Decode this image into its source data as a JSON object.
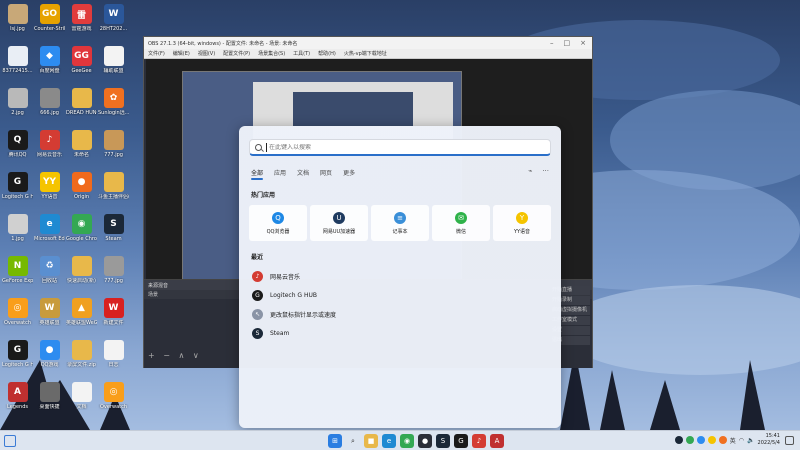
{
  "desktop": {
    "icons": [
      {
        "label": "lsj.jpg",
        "color": "#c8a878",
        "glyph": ""
      },
      {
        "label": "Counter-Strike Global Off...",
        "color": "#e6a200",
        "glyph": "GO"
      },
      {
        "label": "雷霆游戏",
        "color": "#e03c3c",
        "glyph": "雷"
      },
      {
        "label": "28HT202...",
        "color": "#2b579a",
        "glyph": "W"
      },
      {
        "label": "8377241​5...",
        "color": "#e9eef5",
        "glyph": ""
      },
      {
        "label": "百度网盘",
        "color": "#2d8cf0",
        "glyph": "◆"
      },
      {
        "label": "GeeGee",
        "color": "#e0363c",
        "glyph": "GG"
      },
      {
        "label": "辅助联盟",
        "color": "#f3f3f3",
        "glyph": ""
      },
      {
        "label": "2.jpg",
        "color": "#b9b9b9",
        "glyph": ""
      },
      {
        "label": "666.jpg",
        "color": "#8a8a8a",
        "glyph": ""
      },
      {
        "label": "DREAD HUNGER",
        "color": "#e8b84a",
        "glyph": ""
      },
      {
        "label": "Sunlogin远...",
        "color": "#f07020",
        "glyph": "✿"
      },
      {
        "label": "腾讯QQ",
        "color": "#1a1a1a",
        "glyph": "Q"
      },
      {
        "label": "网易云音乐",
        "color": "#d43c33",
        "glyph": "♪"
      },
      {
        "label": "未命名",
        "color": "#e8b84a",
        "glyph": ""
      },
      {
        "label": "777.jpg",
        "color": "#c89858",
        "glyph": ""
      },
      {
        "label": "Logitech G HUB",
        "color": "#1a1a1a",
        "glyph": "G"
      },
      {
        "label": "YY语音",
        "color": "#f5c400",
        "glyph": "YY"
      },
      {
        "label": "Origin",
        "color": "#f06a1c",
        "glyph": "●"
      },
      {
        "label": "斗鱼主播伴侣(新)",
        "color": "#e8b84a",
        "glyph": ""
      },
      {
        "label": "1.jpg",
        "color": "#d0d0d0",
        "glyph": ""
      },
      {
        "label": "Microsoft Edge",
        "color": "#1f8ad2",
        "glyph": "e"
      },
      {
        "label": "Google Chrome",
        "color": "#34a853",
        "glyph": "◉"
      },
      {
        "label": "Steam",
        "color": "#1b2838",
        "glyph": "S"
      },
      {
        "label": "GeForce Experience",
        "color": "#76b900",
        "glyph": "N"
      },
      {
        "label": "回收站",
        "color": "#5a8fd0",
        "glyph": "♻"
      },
      {
        "label": "快速启动(新)",
        "color": "#e8b84a",
        "glyph": ""
      },
      {
        "label": "777.jpg",
        "color": "#9a9a9a",
        "glyph": ""
      },
      {
        "label": "Overwatch",
        "color": "#f99e1a",
        "glyph": "◎"
      },
      {
        "label": "英雄联盟",
        "color": "#c89b3c",
        "glyph": "W"
      },
      {
        "label": "英雄联盟WeGame",
        "color": "#f0a020",
        "glyph": "▲"
      },
      {
        "label": "新建文件",
        "color": "#d82020",
        "glyph": "W"
      },
      {
        "label": "Logitech G HUB",
        "color": "#1a1a1a",
        "glyph": "G"
      },
      {
        "label": "QQ游戏",
        "color": "#2d8cf0",
        "glyph": "●"
      },
      {
        "label": "录屏文件.zip",
        "color": "#e8b84a",
        "glyph": ""
      },
      {
        "label": "日志",
        "color": "#f3f3f3",
        "glyph": ""
      },
      {
        "label": "Legends",
        "color": "#c03030",
        "glyph": "A"
      },
      {
        "label": "桌面快捷",
        "color": "#6a6a6a",
        "glyph": ""
      },
      {
        "label": "文档",
        "color": "#f3f3f3",
        "glyph": ""
      },
      {
        "label": "Overwatch",
        "color": "#f99e1a",
        "glyph": "◎"
      }
    ]
  },
  "obs": {
    "title": "OBS 27.1.3 (64-bit, windows) - 配置文件: 未命名 - 场景: 未命名",
    "menu": [
      "文件(F)",
      "编辑(E)",
      "视图(V)",
      "配置文件(P)",
      "场景集合(S)",
      "工具(T)",
      "帮助(H)",
      "火热-vp端下载地址"
    ],
    "dock_scene_title": "来源混音",
    "dock_scene_sub": "场景",
    "dock_source_title": "来源",
    "dock_tools": "+ − ∧ ∨",
    "right_items": [
      "开始直播",
      "开始录制",
      "启动虚拟摄像机",
      "工作室模式",
      "设置",
      "退出"
    ]
  },
  "start_menu": {
    "search_placeholder": "在此键入以搜索",
    "tabs": [
      "全部",
      "应用",
      "文档",
      "网页",
      "更多"
    ],
    "pinned_title": "热门应用",
    "pinned_apps": [
      {
        "label": "QQ浏览器",
        "color": "#1e88e5",
        "glyph": "Q"
      },
      {
        "label": "网易UU加速器",
        "color": "#1f3b60",
        "glyph": "U"
      },
      {
        "label": "记事本",
        "color": "#3a8fd8",
        "glyph": "≡"
      },
      {
        "label": "微信",
        "color": "#2fb24a",
        "glyph": "✉"
      },
      {
        "label": "YY语音",
        "color": "#f5c400",
        "glyph": "Y"
      }
    ],
    "recent_title": "最近",
    "recent_items": [
      {
        "label": "网易云音乐",
        "color": "#d43c33",
        "glyph": "♪"
      },
      {
        "label": "Logitech G HUB",
        "color": "#1a1a1a",
        "glyph": "G"
      },
      {
        "label": "更改鼠标指针显示或速度",
        "color": "#8a94a6",
        "glyph": "↖"
      },
      {
        "label": "Steam",
        "color": "#1b2838",
        "glyph": "S"
      }
    ]
  },
  "taskbar": {
    "apps": [
      {
        "name": "windows",
        "color": "#2a7de1",
        "glyph": "⊞"
      },
      {
        "name": "search",
        "color": "#dde5f0",
        "glyph": "⌕"
      },
      {
        "name": "file-explorer",
        "color": "#e8b84a",
        "glyph": "■"
      },
      {
        "name": "edge",
        "color": "#1f8ad2",
        "glyph": "e"
      },
      {
        "name": "chrome",
        "color": "#34a853",
        "glyph": "◉"
      },
      {
        "name": "obs",
        "color": "#2b2e38",
        "glyph": "●"
      },
      {
        "name": "steam",
        "color": "#1b2838",
        "glyph": "S"
      },
      {
        "name": "logitech",
        "color": "#1a1a1a",
        "glyph": "G"
      },
      {
        "name": "netease-music",
        "color": "#d43c33",
        "glyph": "♪"
      },
      {
        "name": "lol",
        "color": "#c03030",
        "glyph": "A"
      }
    ],
    "time": "15:41",
    "date": "2022/5/4",
    "lang": "英"
  }
}
